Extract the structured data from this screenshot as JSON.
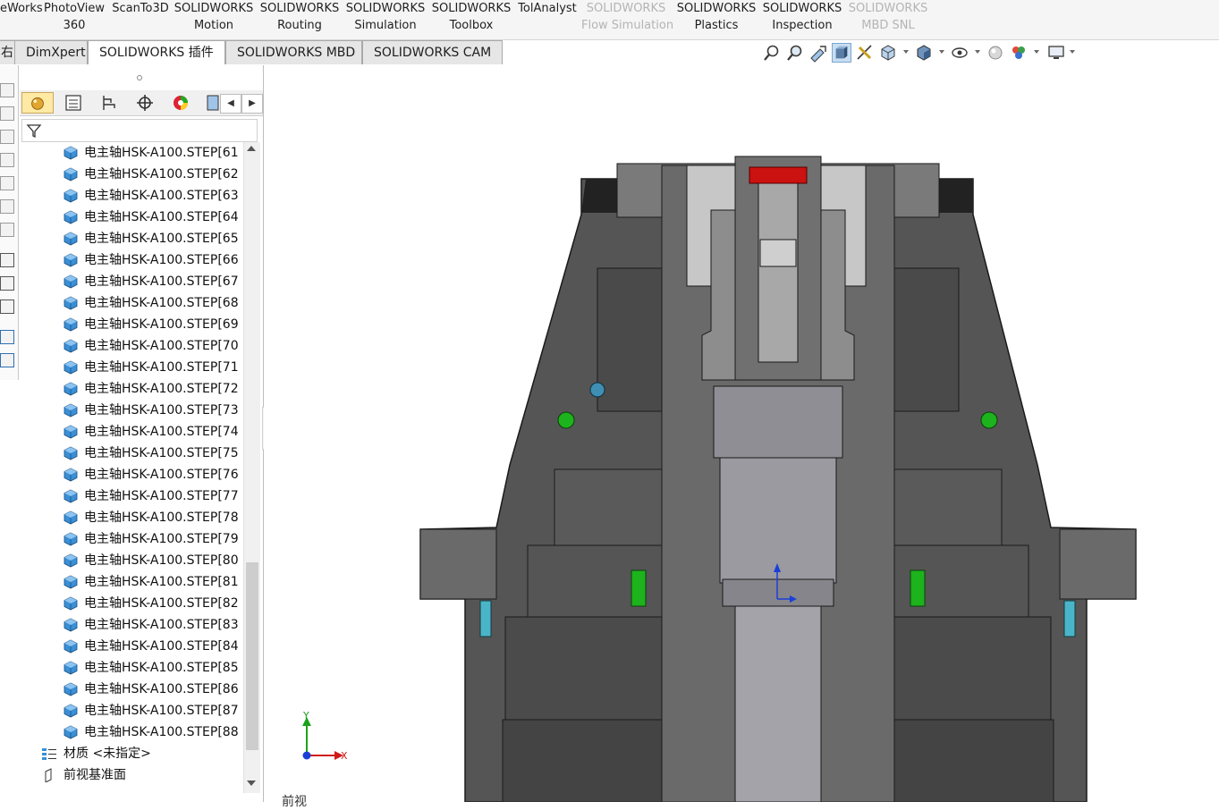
{
  "ribbon": {
    "items": [
      {
        "line1": "eWorks",
        "line2": "",
        "disabled": false
      },
      {
        "line1": "PhotoView",
        "line2": "360",
        "disabled": false
      },
      {
        "line1": "ScanTo3D",
        "line2": "",
        "disabled": false
      },
      {
        "line1": "SOLIDWORKS",
        "line2": "Motion",
        "disabled": false
      },
      {
        "line1": "SOLIDWORKS",
        "line2": "Routing",
        "disabled": false
      },
      {
        "line1": "SOLIDWORKS",
        "line2": "Simulation",
        "disabled": false
      },
      {
        "line1": "SOLIDWORKS",
        "line2": "Toolbox",
        "disabled": false
      },
      {
        "line1": "TolAnalyst",
        "line2": "",
        "disabled": false
      },
      {
        "line1": "SOLIDWORKS",
        "line2": "Flow Simulation",
        "disabled": true
      },
      {
        "line1": "SOLIDWORKS",
        "line2": "Plastics",
        "disabled": false
      },
      {
        "line1": "SOLIDWORKS",
        "line2": "Inspection",
        "disabled": false
      },
      {
        "line1": "SOLIDWORKS",
        "line2": "MBD SNL",
        "disabled": true
      }
    ]
  },
  "tabs": [
    {
      "label": "右",
      "active": false
    },
    {
      "label": "DimXpert",
      "active": false
    },
    {
      "label": "SOLIDWORKS 插件",
      "active": true
    },
    {
      "label": "SOLIDWORKS MBD",
      "active": false
    },
    {
      "label": "SOLIDWORKS CAM",
      "active": false
    }
  ],
  "view_toolbar": {
    "icons": [
      "zoom-to-fit-icon",
      "zoom-area-icon",
      "previous-view-icon",
      "section-view-icon",
      "dynamic-annotation-icon",
      "view-orientation-icon",
      "display-style-icon",
      "hide-show-items-icon",
      "edit-appearance-icon",
      "apply-scene-icon",
      "view-settings-icon"
    ]
  },
  "feature_manager": {
    "tabs": [
      "feature-manager-icon",
      "property-manager-icon",
      "configuration-manager-icon",
      "dimxpert-manager-icon",
      "display-manager-icon",
      "cam-manager-icon"
    ],
    "tree_items": [
      "电主轴HSK-A100.STEP[61",
      "电主轴HSK-A100.STEP[62",
      "电主轴HSK-A100.STEP[63",
      "电主轴HSK-A100.STEP[64",
      "电主轴HSK-A100.STEP[65",
      "电主轴HSK-A100.STEP[66",
      "电主轴HSK-A100.STEP[67",
      "电主轴HSK-A100.STEP[68",
      "电主轴HSK-A100.STEP[69",
      "电主轴HSK-A100.STEP[70",
      "电主轴HSK-A100.STEP[71",
      "电主轴HSK-A100.STEP[72",
      "电主轴HSK-A100.STEP[73",
      "电主轴HSK-A100.STEP[74",
      "电主轴HSK-A100.STEP[75",
      "电主轴HSK-A100.STEP[76",
      "电主轴HSK-A100.STEP[77",
      "电主轴HSK-A100.STEP[78",
      "电主轴HSK-A100.STEP[79",
      "电主轴HSK-A100.STEP[80",
      "电主轴HSK-A100.STEP[81",
      "电主轴HSK-A100.STEP[82",
      "电主轴HSK-A100.STEP[83",
      "电主轴HSK-A100.STEP[84",
      "电主轴HSK-A100.STEP[85",
      "电主轴HSK-A100.STEP[86",
      "电主轴HSK-A100.STEP[87",
      "电主轴HSK-A100.STEP[88"
    ],
    "material": "材质 <未指定>",
    "front_plane": "前视基准面"
  },
  "viewport": {
    "triad": {
      "x_label": "X",
      "y_label": "Y"
    },
    "view_label": "前视"
  },
  "colors": {
    "part_icon": "#3a8fd6",
    "housing_dark": "#4b4b4b",
    "housing_mid": "#5f5f5f",
    "shaft": "#9a9aa0",
    "accent_red": "#cc1111",
    "accent_green": "#1cb31c",
    "accent_cyan": "#4ab5c8"
  }
}
